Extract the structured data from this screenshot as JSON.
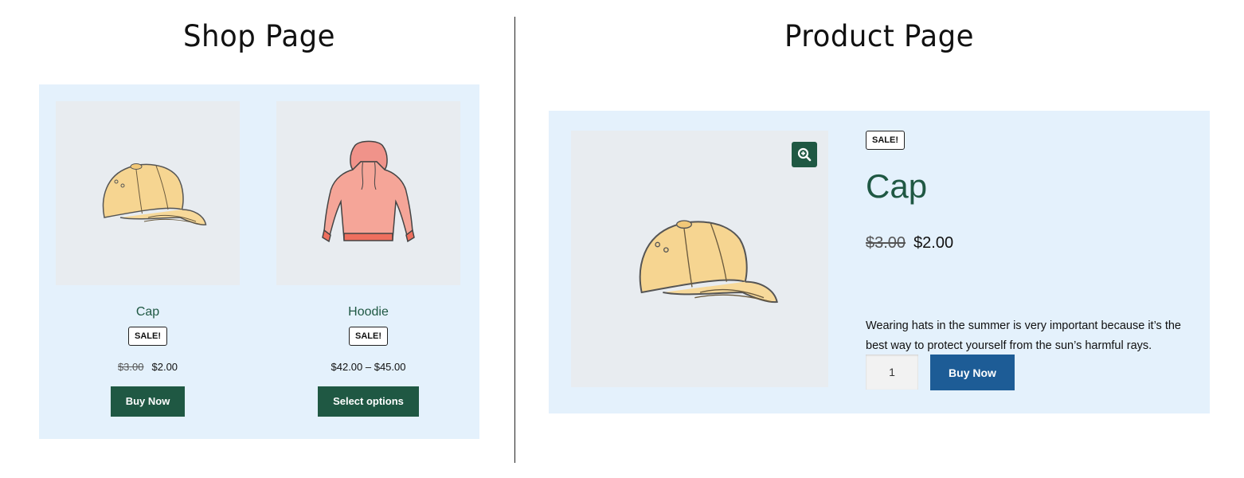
{
  "shop_page": {
    "heading": "Shop Page",
    "products": [
      {
        "name": "Cap",
        "badge": "SALE!",
        "regular_price": "$3.00",
        "sale_price": "$2.00",
        "button_label": "Buy Now",
        "image_icon": "cap-icon"
      },
      {
        "name": "Hoodie",
        "badge": "SALE!",
        "price_range": "$42.00 – $45.00",
        "button_label": "Select options",
        "image_icon": "hoodie-icon"
      }
    ]
  },
  "product_page": {
    "heading": "Product Page",
    "badge": "SALE!",
    "title": "Cap",
    "regular_price": "$3.00",
    "sale_price": "$2.00",
    "description": "Wearing hats in the summer is very important because it’s the best way to protect yourself from the sun’s harmful rays.",
    "quantity": "1",
    "button_label": "Buy Now",
    "zoom_icon": "zoom-in-icon",
    "image_icon": "cap-icon"
  },
  "colors": {
    "panel_bg": "#e4f1fc",
    "image_bg": "#e8ecf0",
    "accent_green": "#1f5843",
    "accent_blue": "#1d5c96"
  }
}
